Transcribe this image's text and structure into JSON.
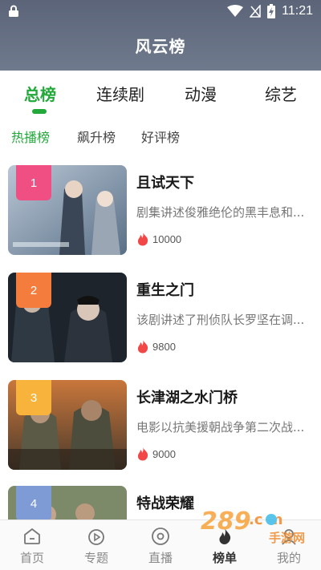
{
  "status": {
    "time": "11:21"
  },
  "header": {
    "title": "风云榜"
  },
  "tabs": [
    {
      "label": "总榜",
      "active": true
    },
    {
      "label": "连续剧",
      "active": false
    },
    {
      "label": "动漫",
      "active": false
    },
    {
      "label": "综艺",
      "active": false
    }
  ],
  "subtabs": [
    {
      "label": "热播榜",
      "active": true
    },
    {
      "label": "飙升榜",
      "active": false
    },
    {
      "label": "好评榜",
      "active": false
    }
  ],
  "items": [
    {
      "rank": "1",
      "title": "且试天下",
      "desc": "剧集讲述俊雅绝伦的黑丰息和...",
      "heat": "10000",
      "badge_color": "#ef4f82"
    },
    {
      "rank": "2",
      "title": "重生之门",
      "desc": "该剧讲述了刑侦队长罗坚在调...",
      "heat": "9800",
      "badge_color": "#f47c3c"
    },
    {
      "rank": "3",
      "title": "长津湖之水门桥",
      "desc": "电影以抗美援朝战争第二次战...",
      "heat": "9000",
      "badge_color": "#f7b33b"
    },
    {
      "rank": "4",
      "title": "特战荣耀",
      "desc": "",
      "heat": "",
      "badge_color": "#7f9bd6"
    }
  ],
  "bottom_nav": [
    {
      "label": "首页",
      "icon": "home-icon",
      "active": false
    },
    {
      "label": "专题",
      "icon": "topic-icon",
      "active": false
    },
    {
      "label": "直播",
      "icon": "live-icon",
      "active": false
    },
    {
      "label": "榜单",
      "icon": "rank-icon",
      "active": true
    },
    {
      "label": "我的",
      "icon": "profile-icon",
      "active": false
    }
  ],
  "watermark": {
    "text": "手游网"
  },
  "colors": {
    "accent": "#22a93a",
    "header": "#5b6478",
    "heat": "#f24747"
  }
}
